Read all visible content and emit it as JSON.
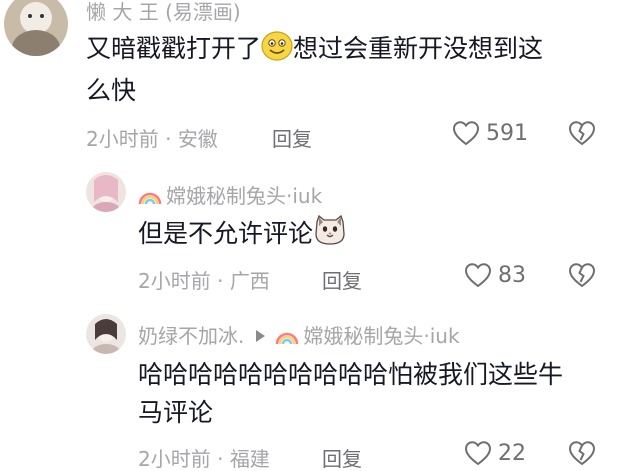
{
  "comments": [
    {
      "author": "懒 大 王 (易漂画)",
      "text_before": "又暗戳戳打开了",
      "emoji1": "smile-emoji",
      "text_after": "想过会重新开没想到这",
      "text_line2": "么快",
      "time": "2小时前",
      "location": "安徽",
      "reply_label": "回复",
      "likes": "591"
    },
    {
      "author": "嫦娥秘制兔头·iuk",
      "text_before": "但是不允许评论",
      "emoji1": "cat-emoji",
      "time": "2小时前",
      "location": "广西",
      "reply_label": "回复",
      "likes": "83"
    },
    {
      "author": "奶绿不加冰.",
      "reply_to": "嫦娥秘制兔头·iuk",
      "text_before": "哈哈哈哈哈哈哈哈哈哈怕被我们这些牛",
      "text_line2": "马评论",
      "time": "2小时前",
      "location": "福建",
      "reply_label": "回复",
      "likes": "22"
    }
  ],
  "separator": " · "
}
